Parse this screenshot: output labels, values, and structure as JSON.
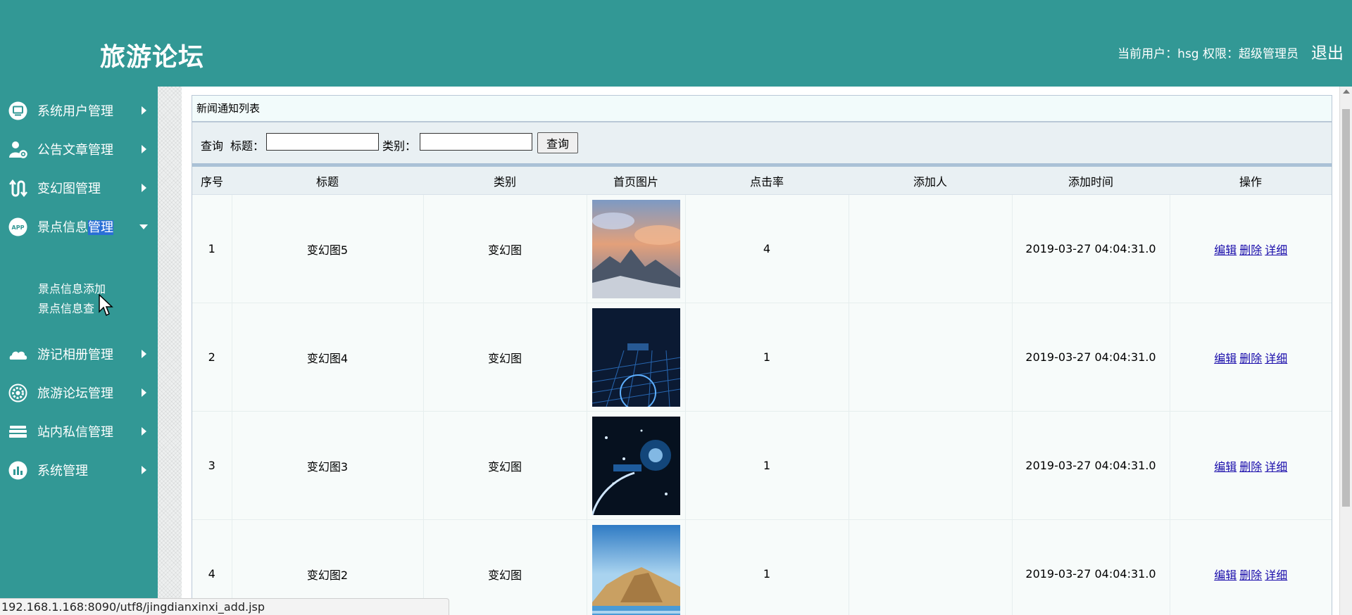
{
  "header": {
    "brand": "旅游论坛",
    "user_info": "当前用户：hsg  权限：超级管理员",
    "logout": "退出",
    "bg_color": "#329895"
  },
  "sidebar": {
    "items": [
      {
        "label": "系统用户管理",
        "icon": "monitor-icon"
      },
      {
        "label": "公告文章管理",
        "icon": "user-gear-icon"
      },
      {
        "label": "变幻图管理",
        "icon": "transfer-icon"
      },
      {
        "label_pre": "景点信息",
        "label_hl": "管理",
        "icon": "app-icon",
        "expanded": true
      },
      {
        "label": "游记相册管理",
        "icon": "cloud-icon"
      },
      {
        "label": "旅游论坛管理",
        "icon": "settings-icon"
      },
      {
        "label": "站内私信管理",
        "icon": "server-icon"
      },
      {
        "label": "系统管理",
        "icon": "chart-icon"
      }
    ],
    "submenu": [
      "景点信息添加",
      "景点信息查"
    ]
  },
  "panel": {
    "title": "新闻通知列表",
    "search": {
      "query_label": "查询",
      "title_label": "标题：",
      "category_label": "类别：",
      "title_value": "",
      "category_value": "",
      "button": "查询"
    }
  },
  "table": {
    "columns": [
      "序号",
      "标题",
      "类别",
      "首页图片",
      "点击率",
      "添加人",
      "添加时间",
      "操作"
    ],
    "rows": [
      {
        "id": "1",
        "title": "变幻图5",
        "category": "变幻图",
        "clicks": "4",
        "adder": "",
        "time": "2019-03-27 04:04:31.0"
      },
      {
        "id": "2",
        "title": "变幻图4",
        "category": "变幻图",
        "clicks": "1",
        "adder": "",
        "time": "2019-03-27 04:04:31.0"
      },
      {
        "id": "3",
        "title": "变幻图3",
        "category": "变幻图",
        "clicks": "1",
        "adder": "",
        "time": "2019-03-27 04:04:31.0"
      },
      {
        "id": "4",
        "title": "变幻图2",
        "category": "变幻图",
        "clicks": "1",
        "adder": "",
        "time": "2019-03-27 04:04:31.0"
      }
    ],
    "actions": {
      "edit": "编辑",
      "delete": "删除",
      "detail": "详细"
    }
  },
  "status_url": "192.168.1.168:8090/utf8/jingdianxinxi_add.jsp"
}
